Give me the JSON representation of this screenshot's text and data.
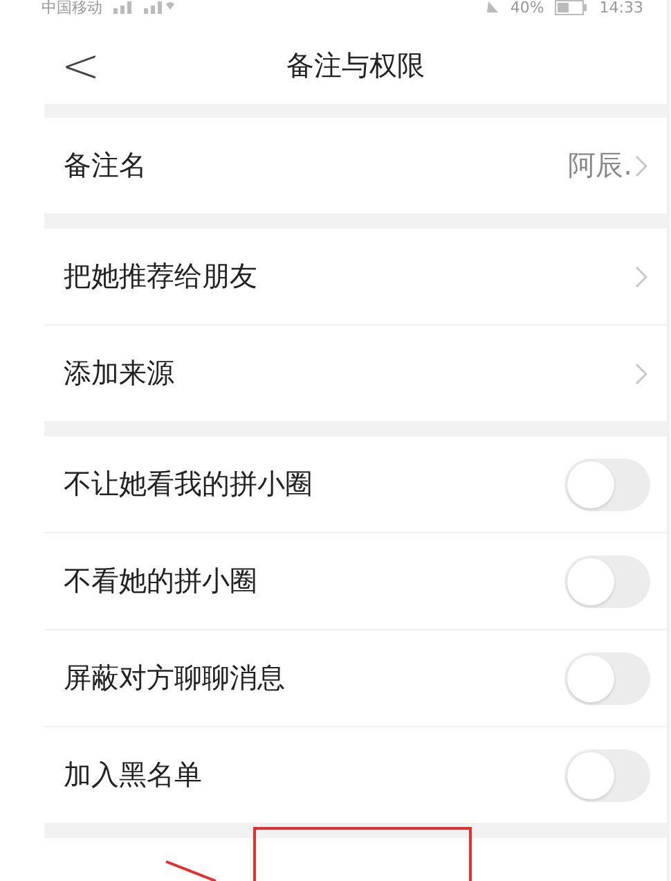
{
  "status_bar": {
    "carrier": "中国移动",
    "battery": "40%",
    "time": "14:33"
  },
  "header": {
    "back": "<",
    "title": "备注与权限"
  },
  "sections": [
    {
      "items": [
        {
          "kind": "value",
          "label": "备注名",
          "value": "阿辰."
        }
      ]
    },
    {
      "items": [
        {
          "kind": "link",
          "label": "把她推荐给朋友"
        },
        {
          "kind": "link",
          "label": "添加来源"
        }
      ]
    },
    {
      "items": [
        {
          "kind": "toggle",
          "label": "不让她看我的拼小圈",
          "on": false
        },
        {
          "kind": "toggle",
          "label": "不看她的拼小圈",
          "on": false
        },
        {
          "kind": "toggle",
          "label": "屏蔽对方聊聊消息",
          "on": false
        },
        {
          "kind": "toggle",
          "label": "加入黑名单",
          "on": false
        }
      ]
    }
  ]
}
